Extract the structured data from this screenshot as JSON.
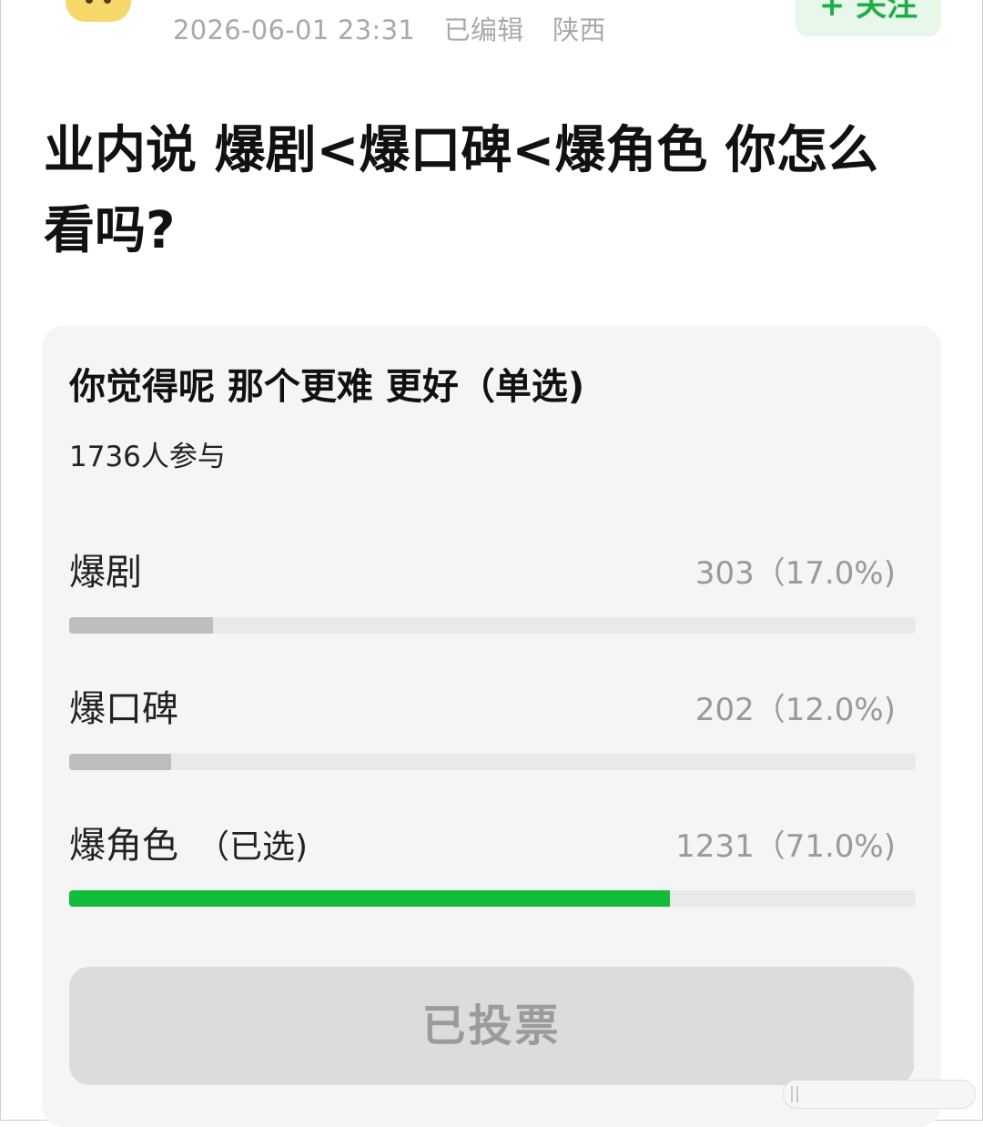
{
  "header": {
    "timestamp": "2026-06-01 23:31",
    "edited": "已编辑",
    "location": "陕西",
    "follow_label": "+ 关注"
  },
  "post": {
    "title": "业内说 爆剧<爆口碑<爆角色 你怎么看吗?"
  },
  "poll": {
    "question": "你觉得呢 那个更难 更好（单选)",
    "participants": "1736人参与",
    "options": [
      {
        "label": "爆剧",
        "selected_tag": "",
        "count_text": "303（17.0%)",
        "votes": 303,
        "percent": 17.0,
        "selected": false
      },
      {
        "label": "爆口碑",
        "selected_tag": "",
        "count_text": "202（12.0%)",
        "votes": 202,
        "percent": 12.0,
        "selected": false
      },
      {
        "label": "爆角色",
        "selected_tag": "（已选)",
        "count_text": "1231（71.0%)",
        "votes": 1231,
        "percent": 71.0,
        "selected": true
      }
    ],
    "voted_label": "已投票"
  },
  "colors": {
    "selected_bar": "#10bc3a",
    "unselected_bar": "#bdbdbd",
    "follow_text": "#1fae45"
  }
}
